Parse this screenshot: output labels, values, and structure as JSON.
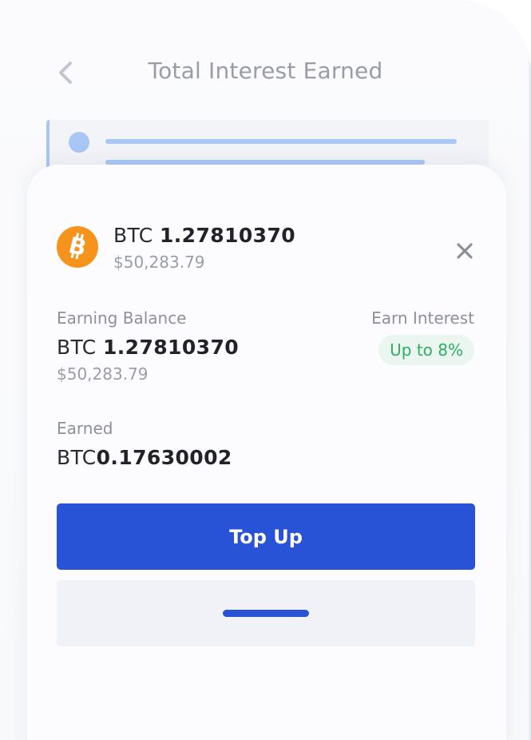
{
  "header": {
    "title": "Total Interest Earned",
    "back_icon": "chevron-left-icon"
  },
  "asset": {
    "icon": "bitcoin-icon",
    "icon_color": "#f5931c",
    "ticker": "BTC",
    "amount": "1.27810370",
    "usd": "$50,283.79"
  },
  "earning_balance": {
    "label": "Earning Balance",
    "ticker": "BTC",
    "amount": "1.27810370",
    "usd": "$50,283.79"
  },
  "earn_interest": {
    "label": "Earn Interest",
    "badge": "Up to 8%",
    "badge_color": "#2dae62"
  },
  "earned": {
    "label": "Earned",
    "ticker": "BTC",
    "amount": "0.17630002"
  },
  "actions": {
    "primary_label": "Top Up",
    "accent_color": "#2853d6"
  }
}
